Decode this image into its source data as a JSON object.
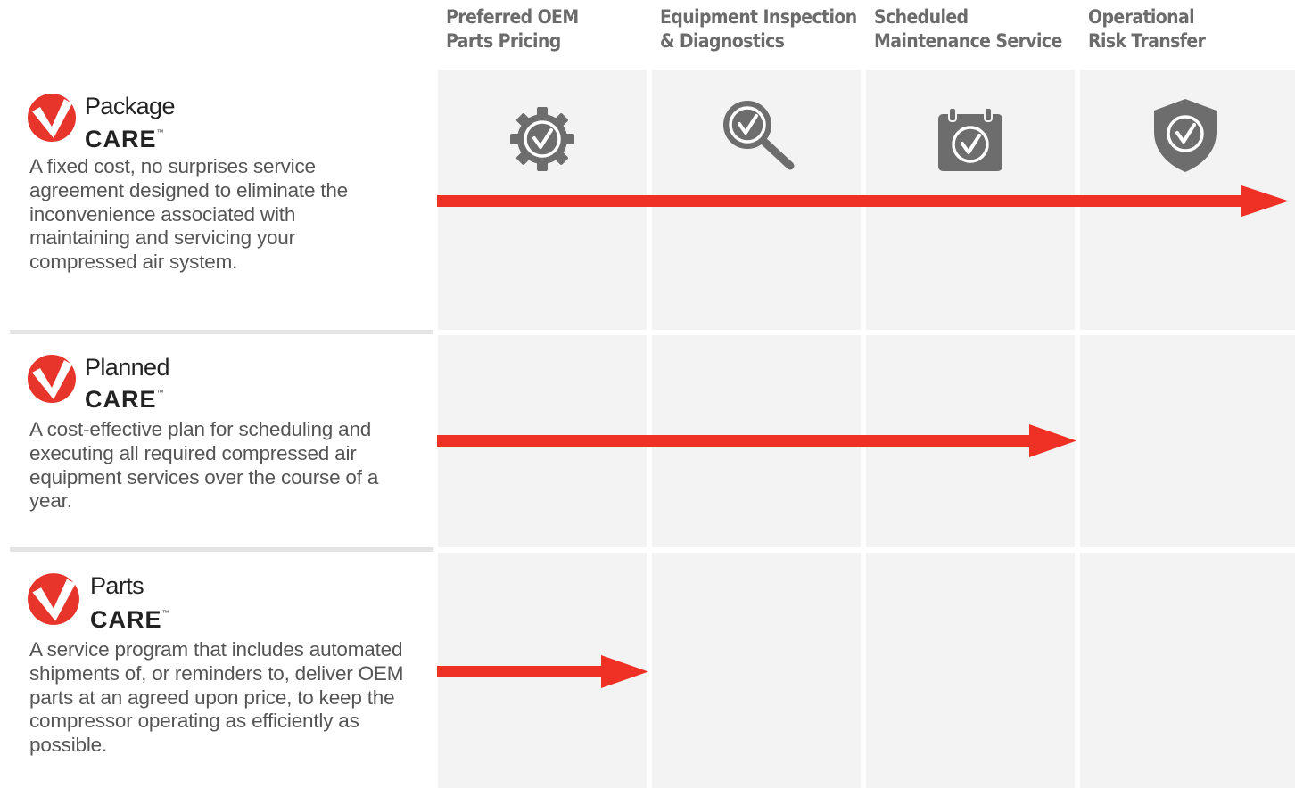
{
  "columns": [
    {
      "line1": "Preferred OEM",
      "line2": "Parts Pricing",
      "icon": "gear-check-icon"
    },
    {
      "line1": "Equipment Inspection",
      "line2": "& Diagnostics",
      "icon": "magnifier-check-icon"
    },
    {
      "line1": "Scheduled",
      "line2": "Maintenance Service",
      "icon": "calendar-check-icon"
    },
    {
      "line1": "Operational",
      "line2": "Risk Transfer",
      "icon": "shield-check-icon"
    }
  ],
  "plans": [
    {
      "name": "Package",
      "care": "CARE",
      "tm": "™",
      "description": "A fixed cost, no surprises service agreement designed to eliminate the inconvenience associated with maintaining and servicing your compressed air system.",
      "columns_covered": 4
    },
    {
      "name": "Planned",
      "care": "CARE",
      "tm": "™",
      "description": "A cost-effective plan for scheduling and executing all required compressed air equipment services over the course of a year.",
      "columns_covered": 3
    },
    {
      "name": "Parts",
      "care": "CARE",
      "tm": "™",
      "description": "A service program that includes automated shipments of, or reminders to, deliver OEM parts at an agreed upon price, to keep the compressor operating as efficiently as possible.",
      "columns_covered": 1
    }
  ],
  "colors": {
    "arrow": "#ee3124",
    "logo": "#e8352b",
    "icon": "#6d6d6d",
    "cell": "#f3f3f3",
    "header_text": "#6b6b6b",
    "body_text": "#555555"
  }
}
